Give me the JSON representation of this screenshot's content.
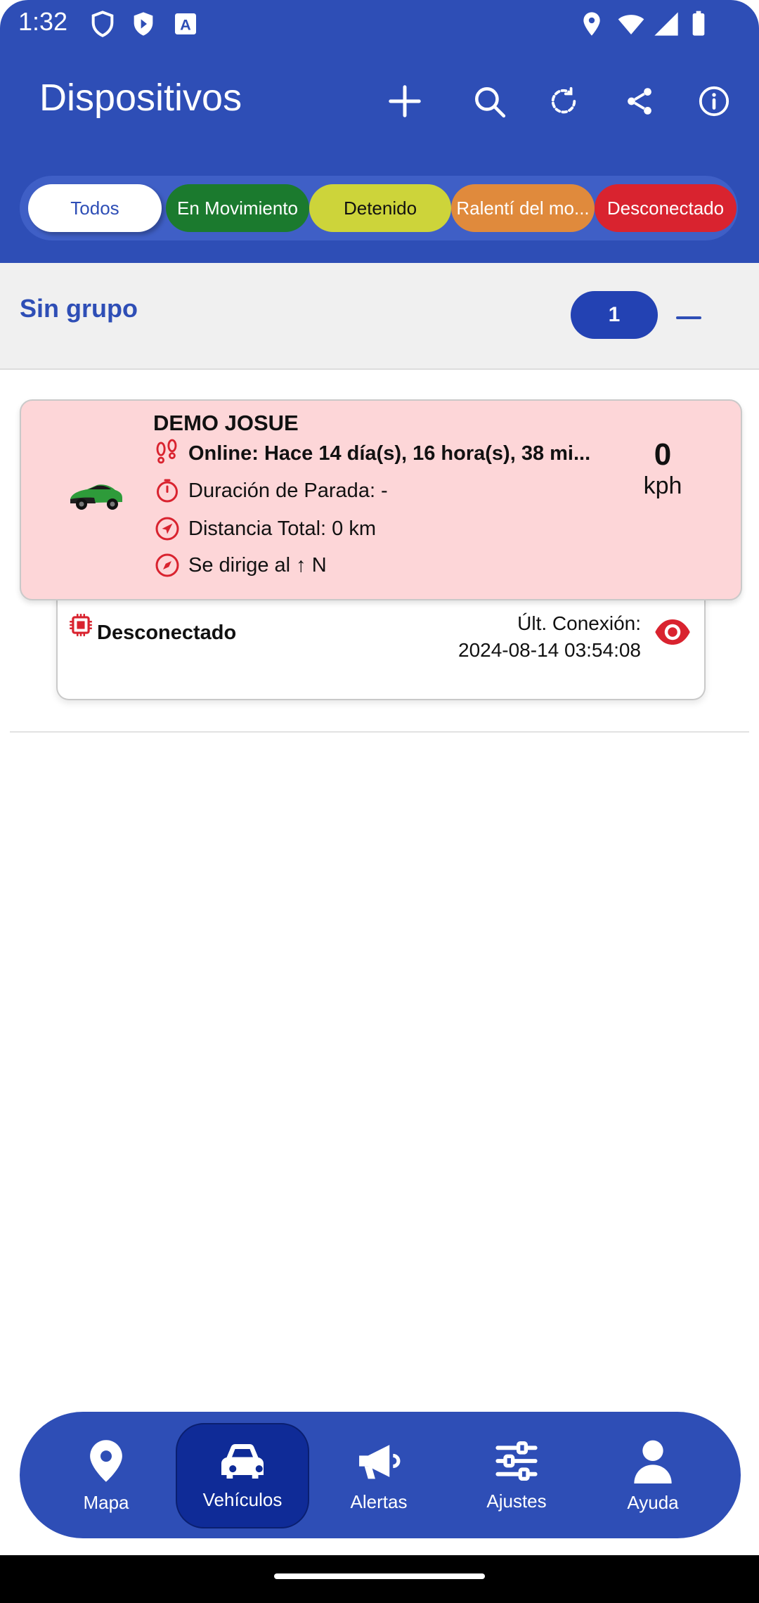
{
  "status_bar": {
    "time": "1:32"
  },
  "header": {
    "title": "Dispositivos",
    "actions": [
      "add-icon",
      "search-icon",
      "refresh-icon",
      "share-icon",
      "info-icon"
    ]
  },
  "filters": [
    {
      "label": "Todos",
      "bg": "#ffffff",
      "fg": "#2e4eb6"
    },
    {
      "label": "En Movimiento",
      "bg": "#1b7a2e",
      "fg": "#ffffff"
    },
    {
      "label": "Detenido",
      "bg": "#cdd43a",
      "fg": "#111111"
    },
    {
      "label": "Ralentí del mo...",
      "bg": "#e08a3c",
      "fg": "#ffffff"
    },
    {
      "label": "Desconectado",
      "bg": "#d9232f",
      "fg": "#ffffff"
    }
  ],
  "group": {
    "title": "Sin grupo",
    "count": "1"
  },
  "device": {
    "name": "DEMO JOSUE",
    "online": "Online: Hace 14 día(s), 16 hora(s), 38 mi...",
    "stop_duration": "Duración de Parada: -",
    "total_distance": "Distancia Total: 0 km",
    "heading": "Se dirige al ↑ N",
    "speed_value": "0",
    "speed_unit": "kph",
    "status": "Desconectado",
    "last_conn_label": "Últ. Conexión:",
    "last_conn_value": "2024-08-14 03:54:08",
    "accent": "#d9232f"
  },
  "bottom_nav": [
    {
      "label": "Mapa",
      "icon": "map-pin-icon"
    },
    {
      "label": "Vehículos",
      "icon": "car-icon",
      "active": true
    },
    {
      "label": "Alertas",
      "icon": "megaphone-icon"
    },
    {
      "label": "Ajustes",
      "icon": "sliders-icon"
    },
    {
      "label": "Ayuda",
      "icon": "person-icon"
    }
  ],
  "colors": {
    "primary": "#2e4eb6",
    "active_nav": "#0f2b97",
    "alert_card": "#fdd6d8"
  }
}
